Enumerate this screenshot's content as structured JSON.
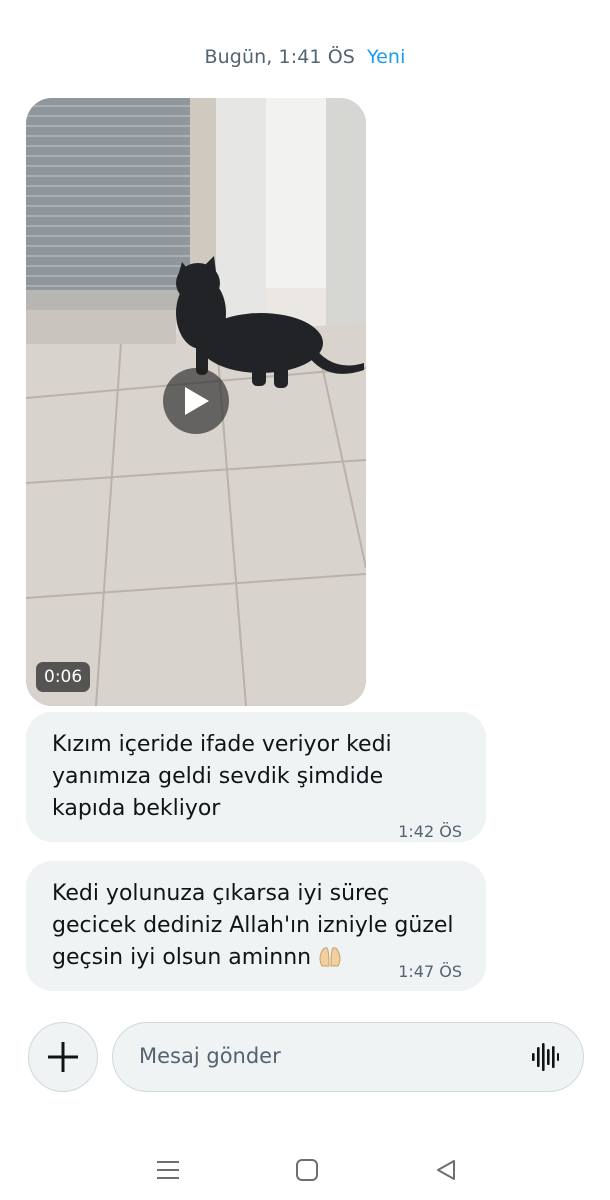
{
  "header": {
    "timestamp": "Bugün, 1:41 ÖS",
    "new_label": "Yeni"
  },
  "video": {
    "duration": "0:06",
    "play_icon": "play-icon"
  },
  "messages": [
    {
      "text": "Kızım içeride ifade veriyor kedi yanımıza geldi sevdik şimdide kapıda bekliyor",
      "time": "1:42 ÖS"
    },
    {
      "text": "Kedi yolunuza çıkarsa iyi süreç gecicek dediniz Allah'ın izniyle güzel geçsin iyi olsun aminnn",
      "emoji": "praying-hands-emoji",
      "time": "1:47 ÖS"
    }
  ],
  "composer": {
    "add_icon": "plus-icon",
    "placeholder": "Mesaj gönder",
    "voice_icon": "voice-wave-icon"
  },
  "system_nav": {
    "menu_icon": "recent-apps-icon",
    "home_icon": "home-icon",
    "back_icon": "back-icon"
  },
  "colors": {
    "accent": "#1d9bf0",
    "bubble": "#eff3f4",
    "muted_text": "#536471"
  }
}
